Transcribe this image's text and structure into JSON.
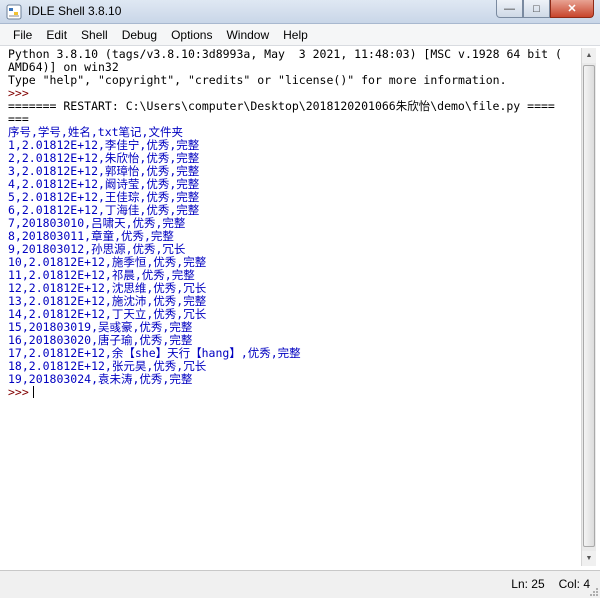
{
  "window": {
    "title": "IDLE Shell 3.8.10",
    "minimize_glyph": "—",
    "maximize_glyph": "□",
    "close_glyph": "✕",
    "icon": "python-idle-icon"
  },
  "menu": [
    "File",
    "Edit",
    "Shell",
    "Debug",
    "Options",
    "Window",
    "Help"
  ],
  "shell": {
    "banner": [
      "Python 3.8.10 (tags/v3.8.10:3d8993a, May  3 2021, 11:48:03) [MSC v.1928 64 bit (",
      "AMD64)] on win32",
      "Type \"help\", \"copyright\", \"credits\" or \"license()\" for more information."
    ],
    "prompt": ">>>",
    "restart_lines": [
      "======= RESTART: C:\\Users\\computer\\Desktop\\2018120201066朱欣怡\\demo\\file.py ====",
      "==="
    ],
    "output": [
      "序号,学号,姓名,txt笔记,文件夹",
      "1,2.01812E+12,李佳宁,优秀,完整",
      "2,2.01812E+12,朱欣怡,优秀,完整",
      "3,2.01812E+12,郭璋怡,优秀,完整",
      "4,2.01812E+12,阚诗莹,优秀,完整",
      "5,2.01812E+12,王佳琮,优秀,完整",
      "6,2.01812E+12,丁海佳,优秀,完整",
      "7,201803010,吕啸天,优秀,完整",
      "8,201803011,章童,优秀,完整",
      "9,201803012,孙思源,优秀,冗长",
      "10,2.01812E+12,施季恒,优秀,完整",
      "11,2.01812E+12,祁晨,优秀,完整",
      "12,2.01812E+12,沈思维,优秀,冗长",
      "13,2.01812E+12,施沈沛,优秀,完整",
      "14,2.01812E+12,丁天立,优秀,冗长",
      "15,201803019,吴彧豪,优秀,完整",
      "16,201803020,唐子瑜,优秀,完整",
      "17,2.01812E+12,余【she】天行【hang】,优秀,完整",
      "18,2.01812E+12,张元昊,优秀,冗长",
      "19,201803024,袁未涛,优秀,完整"
    ],
    "final_prompt": ">>>"
  },
  "status": {
    "line": "Ln: 25",
    "col": "Col: 4"
  },
  "colors": {
    "prompt": "#800000",
    "output": "#0000c0",
    "restart": "#cc0000",
    "stdout_text": "#000000"
  }
}
